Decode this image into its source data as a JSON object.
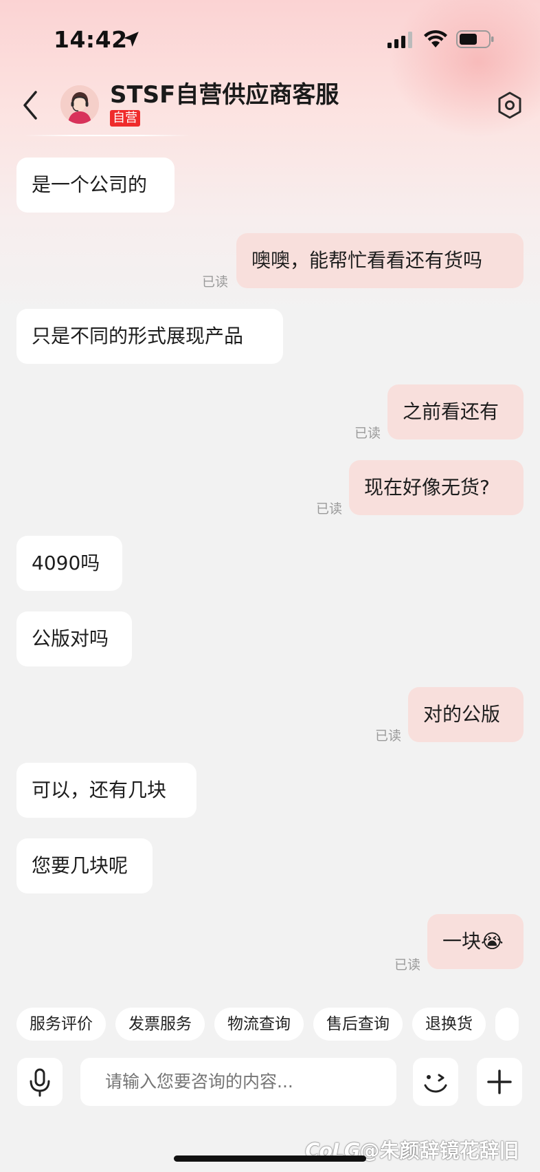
{
  "status_bar": {
    "time": "14:42"
  },
  "header": {
    "title": "STSF自营供应商客服",
    "badge": "自营"
  },
  "messages": [
    {
      "dir": "in",
      "text": "是一个公司的"
    },
    {
      "dir": "out",
      "text": "噢噢，能帮忙看看还有货吗",
      "read": "已读"
    },
    {
      "dir": "in",
      "text": "只是不同的形式展现产品"
    },
    {
      "dir": "out",
      "text": "之前看还有",
      "read": "已读"
    },
    {
      "dir": "out",
      "text": "现在好像无货?",
      "read": "已读"
    },
    {
      "dir": "in",
      "text": "4090吗"
    },
    {
      "dir": "in",
      "text": "公版对吗"
    },
    {
      "dir": "out",
      "text": "对的公版",
      "read": "已读"
    },
    {
      "dir": "in",
      "text": "可以，还有几块"
    },
    {
      "dir": "in",
      "text": "您要几块呢"
    },
    {
      "dir": "out",
      "text": "一块😭",
      "read": "已读"
    }
  ],
  "quick_actions": [
    "服务评价",
    "发票服务",
    "物流查询",
    "售后查询",
    "退换货"
  ],
  "input": {
    "placeholder": "请输入您要咨询的内容..."
  },
  "watermark": {
    "logo": "CoLG",
    "text": "@朱颜辞镜花辞旧"
  }
}
